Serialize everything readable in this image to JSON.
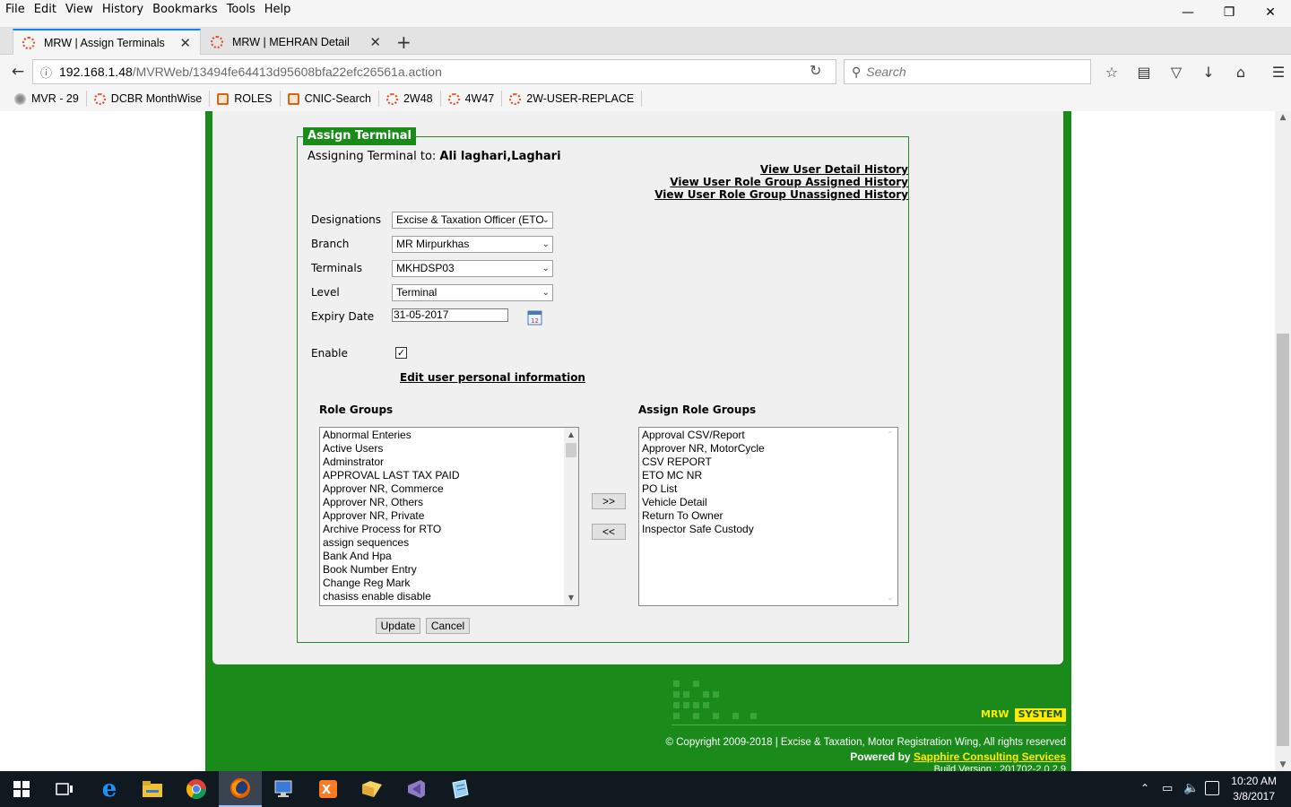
{
  "menu": [
    "File",
    "Edit",
    "View",
    "History",
    "Bookmarks",
    "Tools",
    "Help"
  ],
  "tabs": [
    {
      "title": "MRW | Assign Terminals",
      "active": true
    },
    {
      "title": "MRW | MEHRAN Detail",
      "active": false
    }
  ],
  "url": {
    "host": "192.168.1.48",
    "path": "/MVRWeb/13494fe64413d95608bfa22efc26561a.action"
  },
  "search_placeholder": "Search",
  "bookmarks": [
    "MVR - 29",
    "DCBR MonthWise",
    "ROLES",
    "CNIC-Search",
    "2W48",
    "4W47",
    "2W-USER-REPLACE"
  ],
  "form": {
    "legend": "Assign Terminal",
    "assigning_label": "Assigning Terminal to:",
    "assigning_user": "Ali laghari,Laghari",
    "links": [
      "View User Detail History",
      "View User Role Group Assigned History",
      "View User Role Group Unassigned History"
    ],
    "designations_label": "Designations",
    "designations_value": "Excise & Taxation Officer (ETO",
    "branch_label": "Branch",
    "branch_value": "MR Mirpurkhas",
    "terminals_label": "Terminals",
    "terminals_value": "MKHDSP03",
    "level_label": "Level",
    "level_value": "Terminal",
    "expiry_label": "Expiry Date",
    "expiry_value": "31-05-2017",
    "enable_label": "Enable",
    "enable_checked": true,
    "edit_link": "Edit user personal information",
    "role_groups_label": "Role Groups",
    "assign_role_groups_label": "Assign Role Groups",
    "role_groups": [
      "Abnormal Enteries",
      "Active Users",
      "Adminstrator",
      "APPROVAL LAST TAX PAID",
      "Approver NR, Commerce",
      "Approver NR, Others",
      "Approver NR, Private",
      "Archive Process for RTO",
      "assign sequences",
      "Bank And Hpa",
      "Book Number Entry",
      "Change Reg Mark",
      "chasiss enable disable"
    ],
    "assigned_role_groups": [
      "Approval CSV/Report",
      "Approver NR, MotorCycle",
      "CSV REPORT",
      "ETO MC NR",
      "PO List",
      "Vehicle Detail",
      "Return To Owner",
      "Inspector Safe Custody"
    ],
    "add_button": ">>",
    "remove_button": "<<",
    "update_button": "Update",
    "cancel_button": "Cancel"
  },
  "footer": {
    "brand_mrw": "MRW",
    "brand_system": "SYSTEM",
    "copyright": "© Copyright 2009-2018 | Excise & Taxation, Motor Registration Wing, All rights reserved",
    "powered_label": "Powered by",
    "powered_link": "Sapphire Consulting Services",
    "build": "Build Version : 201702-2.0.2.9"
  },
  "clock": {
    "time": "10:20 AM",
    "date": "3/8/2017"
  },
  "colors": {
    "green": "#1a8a1a",
    "accent": "#0a84ff"
  }
}
